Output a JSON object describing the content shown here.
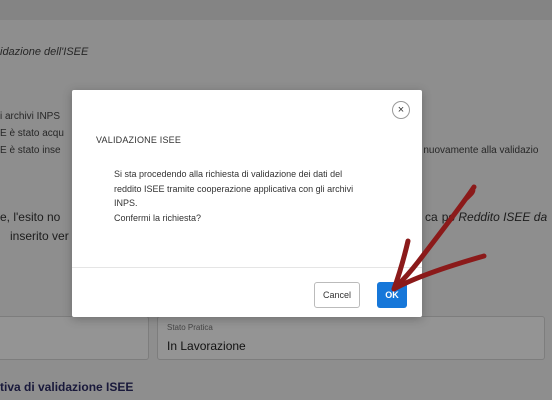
{
  "background": {
    "section_title": "idazione dell'ISEE",
    "line_archivi": "i archivi INPS",
    "line_acq": "E è stato acqu",
    "line_ins": "E è stato inse",
    "line_right": "e nuovamente alla validazio",
    "line_esito": "e, l'esito no",
    "line_inserito": "inserito ver",
    "line_campo_prefix": "ca",
    "line_campo_mid": "po",
    "line_campo_italic": "Reddito ISEE da",
    "stato_label": "Stato Pratica",
    "stato_value": "In Lavorazione",
    "bottom_title": "tiva di validazione ISEE"
  },
  "modal": {
    "close_glyph": "×",
    "title": "VALIDAZIONE ISEE",
    "body_lines": [
      "Si sta procedendo alla richiesta di validazione dei dati del",
      "reddito ISEE tramite cooperazione applicativa con gli archivi",
      "INPS.",
      "Confermi la richiesta?"
    ],
    "cancel_label": "Cancel",
    "ok_label": "OK"
  },
  "colors": {
    "primary_button": "#1677d9",
    "annotation_arrow": "#8b1a1a"
  }
}
